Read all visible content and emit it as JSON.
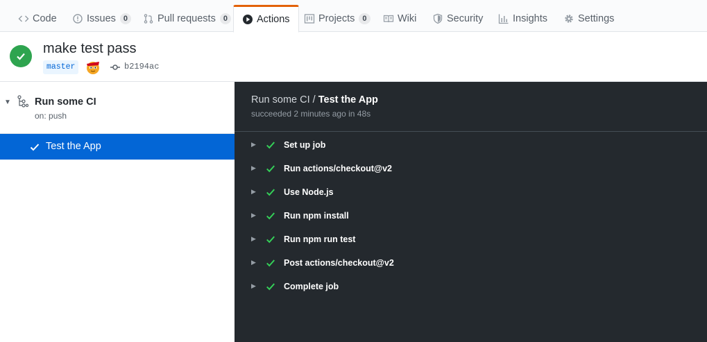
{
  "tabs": [
    {
      "label": "Code",
      "icon": "code-icon"
    },
    {
      "label": "Issues",
      "icon": "issue-icon",
      "count": "0"
    },
    {
      "label": "Pull requests",
      "icon": "pull-request-icon",
      "count": "0"
    },
    {
      "label": "Actions",
      "icon": "play-icon",
      "selected": true
    },
    {
      "label": "Projects",
      "icon": "project-icon",
      "count": "0"
    },
    {
      "label": "Wiki",
      "icon": "book-icon"
    },
    {
      "label": "Security",
      "icon": "shield-icon"
    },
    {
      "label": "Insights",
      "icon": "graph-icon"
    },
    {
      "label": "Settings",
      "icon": "gear-icon"
    }
  ],
  "run": {
    "title": "make test pass",
    "branch": "master",
    "commit": "b2194ac",
    "status": "success"
  },
  "workflow": {
    "name": "Run some CI",
    "trigger": "on: push"
  },
  "job": {
    "name": "Test the App"
  },
  "log": {
    "workflow": "Run some CI",
    "separator": " / ",
    "job": "Test the App",
    "summary": "succeeded 2 minutes ago in 48s",
    "steps": [
      {
        "name": "Set up job"
      },
      {
        "name": "Run actions/checkout@v2"
      },
      {
        "name": "Use Node.js"
      },
      {
        "name": "Run npm install"
      },
      {
        "name": "Run npm run test"
      },
      {
        "name": "Post actions/checkout@v2"
      },
      {
        "name": "Complete job"
      }
    ]
  },
  "colors": {
    "accent": "#e36209",
    "success": "#2ea44f",
    "selected_job": "#0366d6",
    "log_bg": "#24292e"
  }
}
